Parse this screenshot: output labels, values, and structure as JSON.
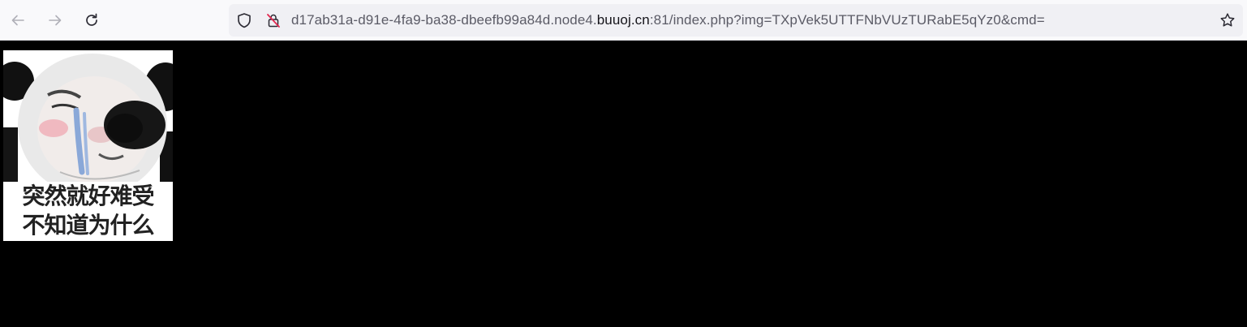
{
  "browser": {
    "url_prefix": "d17ab31a-d91e-4fa9-ba38-dbeefb99a84d.node4.",
    "url_domain": "buuoj.cn",
    "url_suffix": ":81/index.php?img=TXpVek5UTTFNbVUzTURabE5qYz0&cmd=",
    "icons": {
      "back": "back-arrow-icon",
      "forward": "forward-arrow-icon",
      "reload": "reload-icon",
      "tracking": "shield-icon",
      "security": "insecure-lock-icon",
      "bookmark": "star-icon"
    }
  },
  "page": {
    "meme": {
      "caption_line1": "突然就好难受",
      "caption_line2": "不知道为什么"
    }
  }
}
